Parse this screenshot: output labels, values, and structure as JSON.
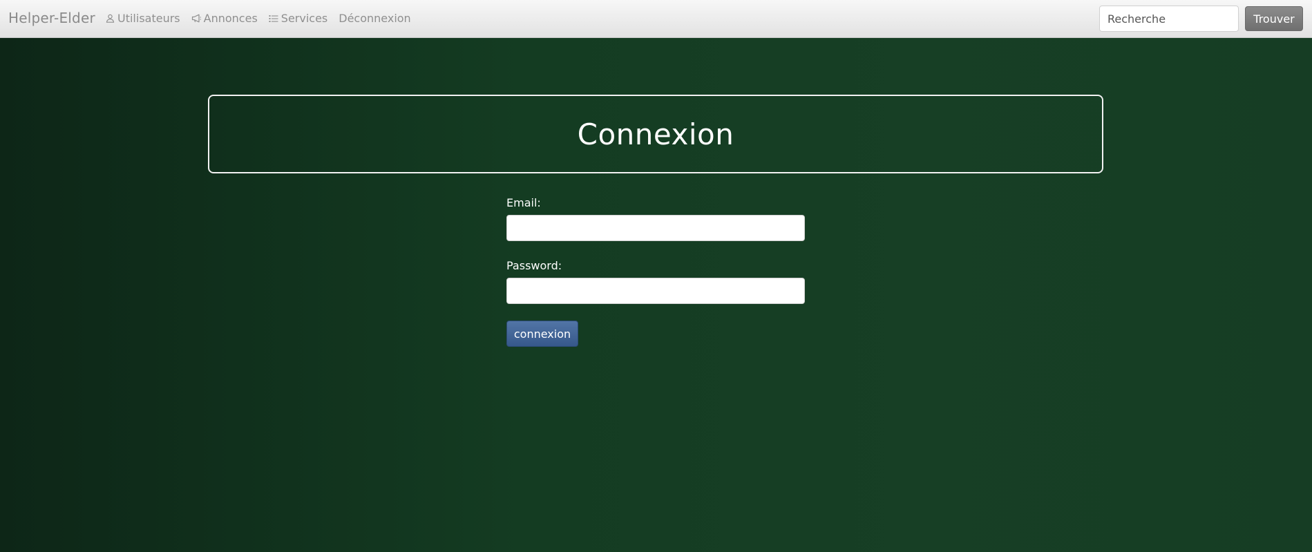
{
  "navbar": {
    "brand": "Helper-Elder",
    "links": [
      {
        "label": "Utilisateurs",
        "icon": "user-icon"
      },
      {
        "label": "Annonces",
        "icon": "megaphone-icon"
      },
      {
        "label": "Services",
        "icon": "list-icon"
      },
      {
        "label": "Déconnexion",
        "icon": ""
      }
    ],
    "search": {
      "placeholder": "Recherche",
      "value": "",
      "button_label": "Trouver"
    }
  },
  "main": {
    "title": "Connexion",
    "form": {
      "email_label": "Email:",
      "email_value": "",
      "password_label": "Password:",
      "password_value": "",
      "submit_label": "connexion"
    }
  },
  "colors": {
    "background_dark": "#0d2617",
    "background_green": "#163d24",
    "submit_button": "#4267a0",
    "search_button": "#7d7d7d"
  }
}
